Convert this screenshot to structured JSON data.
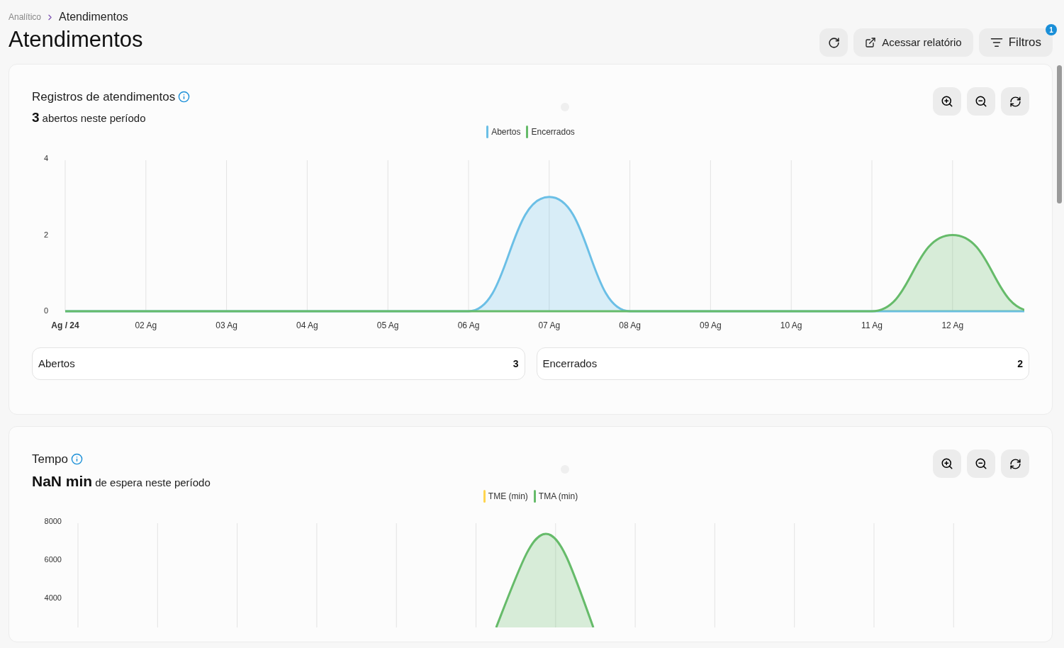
{
  "breadcrumb": [
    {
      "label": "Analítico",
      "current": false
    },
    {
      "label": "Atendimentos",
      "current": true
    }
  ],
  "title": "Atendimentos",
  "header_buttons": [
    {
      "kind": "refresh"
    },
    {
      "kind": "external",
      "label": "Acessar relatório"
    },
    {
      "kind": "filter",
      "label": "Filtros",
      "badge": "1"
    }
  ],
  "cards": [
    {
      "title": "Registros de atendimentos",
      "headline": "3",
      "subtitle": "abertos neste período",
      "chart_data": {
        "type": "area",
        "grid": true,
        "categories": [
          "Ag / 24",
          "02 Ag",
          "03 Ag",
          "04 Ag",
          "05 Ag",
          "06 Ag",
          "07 Ag",
          "08 Ag",
          "09 Ag",
          "10 Ag",
          "11 Ag",
          "12 Ag",
          null
        ],
        "ylim": [
          0,
          4
        ],
        "yticks": [
          0,
          2,
          4
        ],
        "series": [
          {
            "name": "Abertos",
            "color": "#6bbfe6",
            "values": [
              0,
              0,
              0,
              0,
              0,
              0,
              3,
              0,
              0,
              0,
              0,
              0,
              0
            ]
          },
          {
            "name": "Encerrados",
            "color": "#66bb6a",
            "values": [
              0,
              0,
              0,
              0,
              0,
              0,
              0,
              0,
              0,
              0,
              0,
              2,
              0
            ]
          }
        ]
      },
      "totals": [
        {
          "label": "Abertos",
          "value": "3"
        },
        {
          "label": "Encerrados",
          "value": "2"
        }
      ]
    },
    {
      "title": "Tempo",
      "headline": "NaN min",
      "subtitle": "de espera neste período",
      "chart_picture": {
        "legend": [
          {
            "name": "TME (min)",
            "color": "#ffd54f"
          },
          {
            "name": "TMA (min)",
            "color": "#66bb6a"
          }
        ],
        "y_labels": [
          "8000",
          "6000",
          "4000"
        ]
      }
    }
  ]
}
